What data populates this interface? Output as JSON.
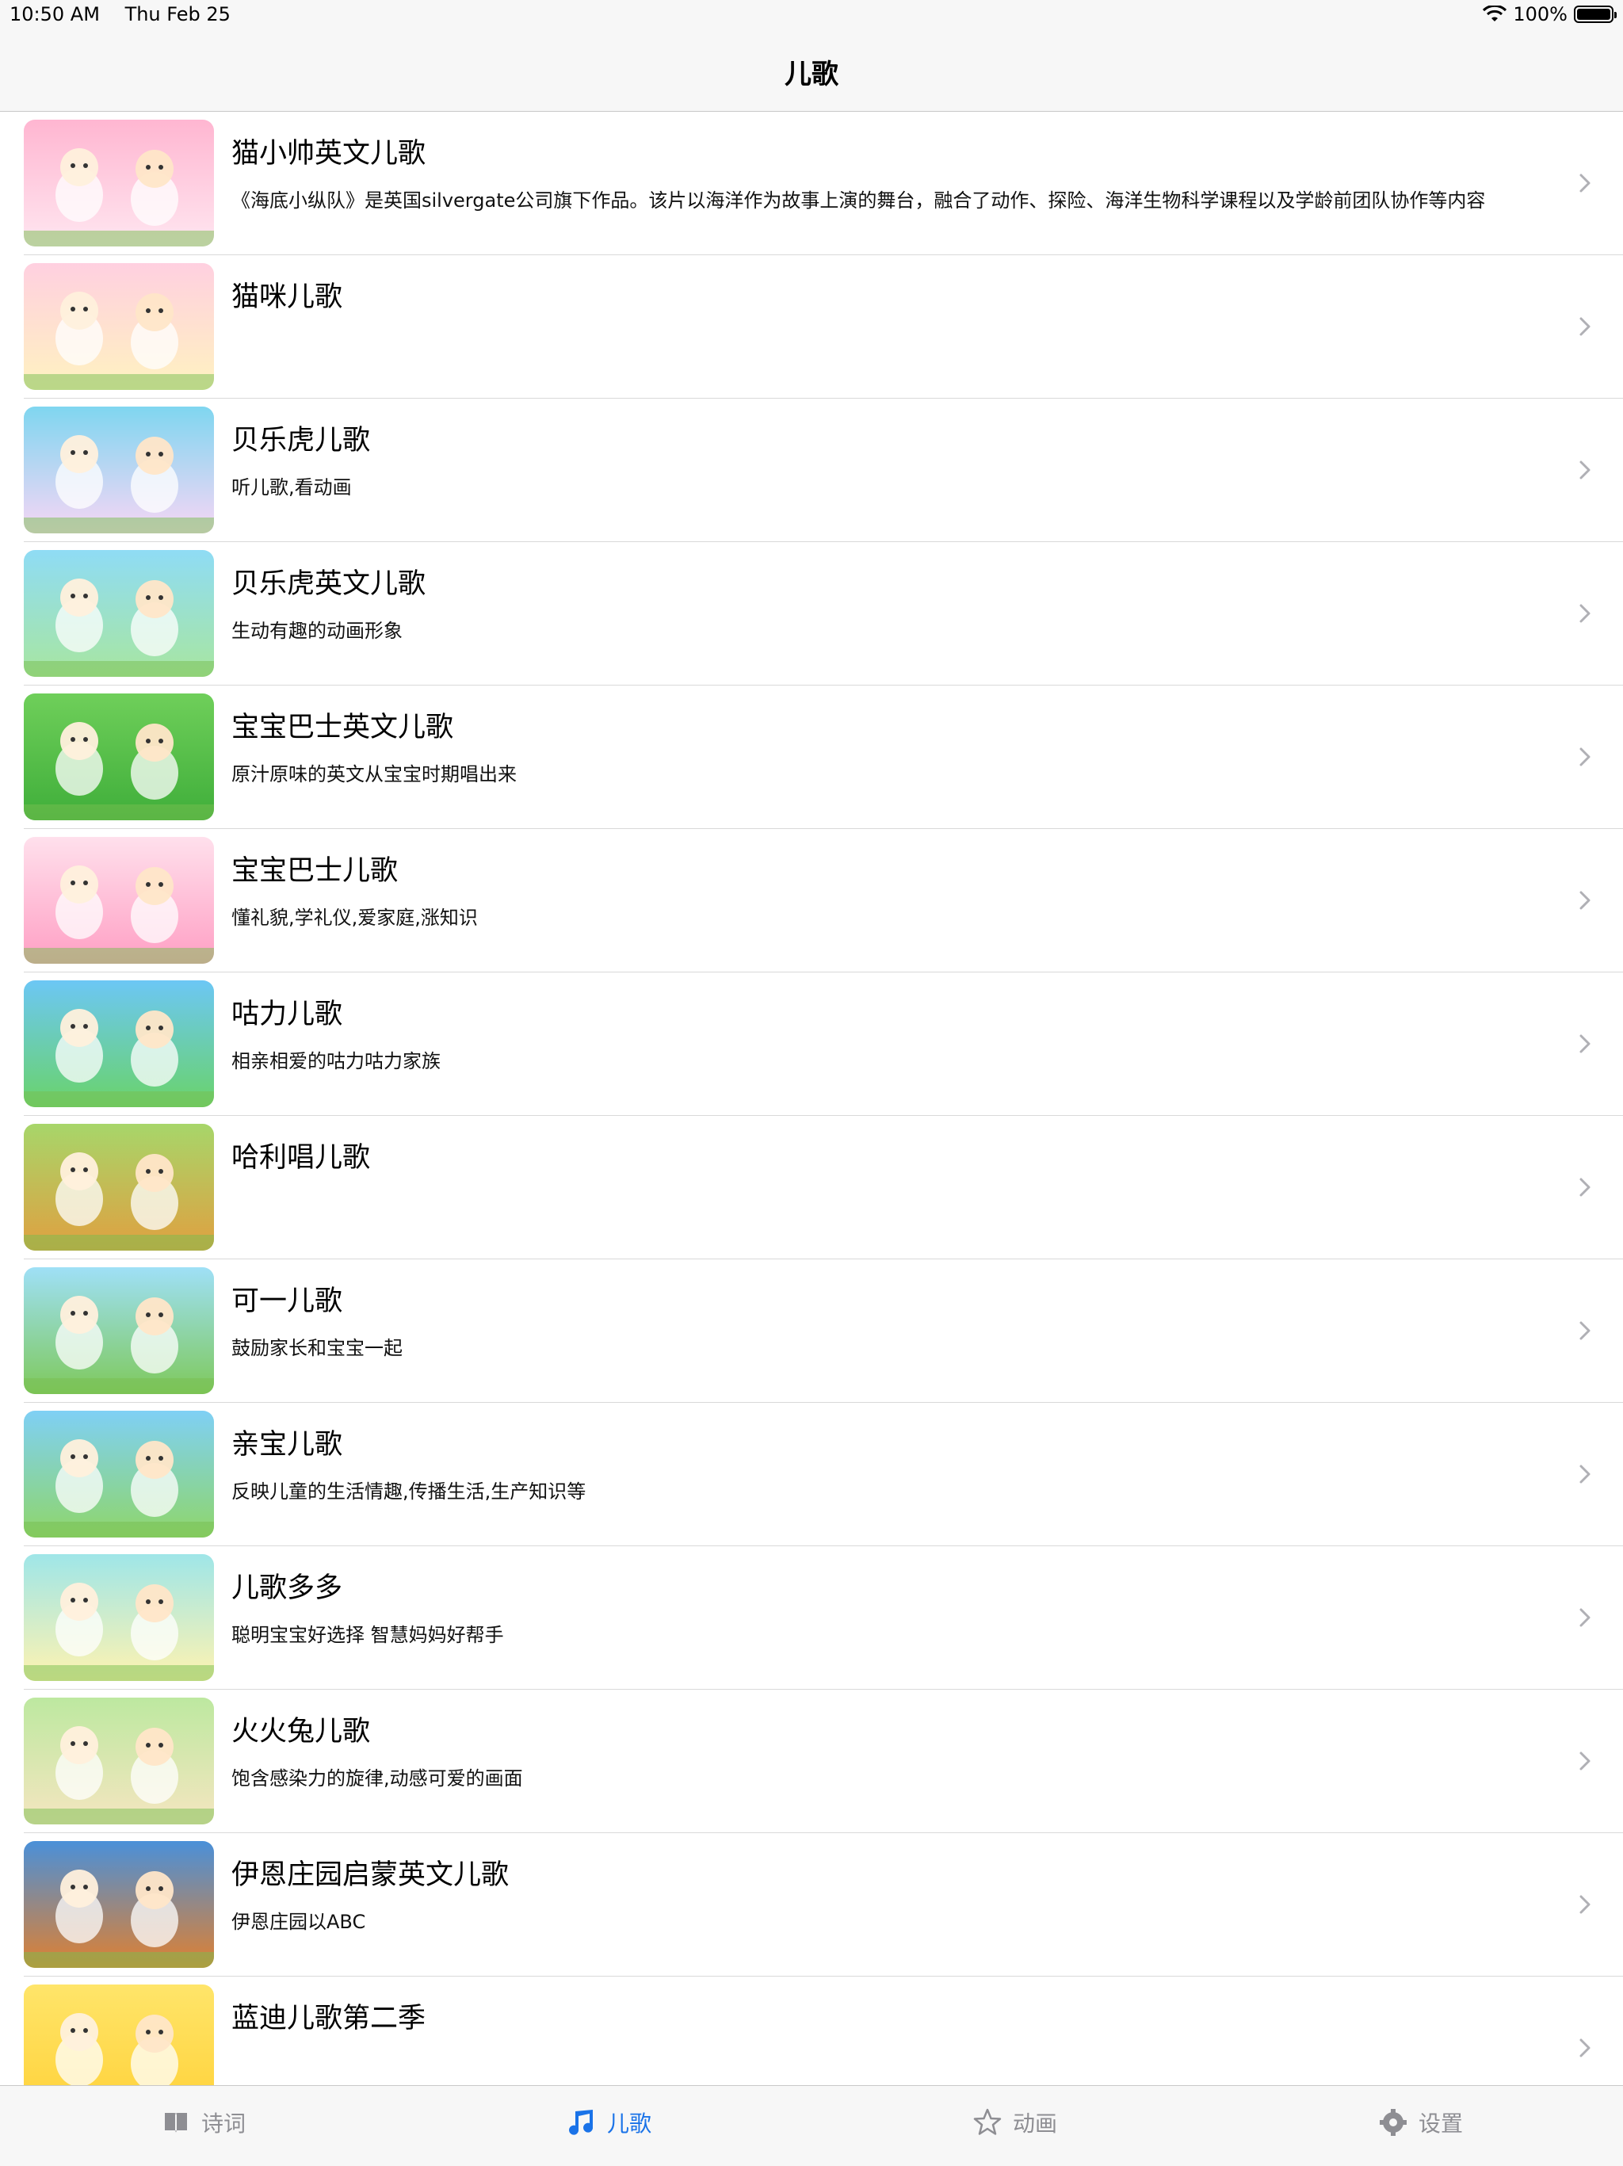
{
  "status": {
    "time": "10:50 AM",
    "date": "Thu Feb 25",
    "battery": "100%",
    "battery_level": 1.0
  },
  "nav": {
    "title": "儿歌"
  },
  "rows": [
    {
      "title": "猫小帅英文儿歌",
      "subtitle": "《海底小纵队》是英国silvergate公司旗下作品。该片以海洋作为故事上演的舞台，融合了动作、探险、海洋生物科学课程以及学龄前团队协作等内容",
      "colors": [
        "#ffb6d1",
        "#ffe6f0"
      ]
    },
    {
      "title": "猫咪儿歌",
      "subtitle": "",
      "colors": [
        "#ffd0e0",
        "#fff2c0"
      ]
    },
    {
      "title": "贝乐虎儿歌",
      "subtitle": "听儿歌,看动画",
      "colors": [
        "#7fd6f0",
        "#f7d6f5"
      ]
    },
    {
      "title": "贝乐虎英文儿歌",
      "subtitle": "生动有趣的动画形象",
      "colors": [
        "#8fdcf5",
        "#a8e6a0"
      ]
    },
    {
      "title": "宝宝巴士英文儿歌",
      "subtitle": "原汁原味的英文从宝宝时期唱出来",
      "colors": [
        "#6fcf5a",
        "#3fae3a"
      ]
    },
    {
      "title": "宝宝巴士儿歌",
      "subtitle": "懂礼貌,学礼仪,爱家庭,涨知识",
      "colors": [
        "#ffe0ec",
        "#ff9fc4"
      ]
    },
    {
      "title": "咕力儿歌",
      "subtitle": "相亲相爱的咕力咕力家族",
      "colors": [
        "#6cc7f5",
        "#6ad36a"
      ]
    },
    {
      "title": "哈利唱儿歌",
      "subtitle": "",
      "colors": [
        "#a7d66a",
        "#e0a040"
      ]
    },
    {
      "title": "可一儿歌",
      "subtitle": "鼓励家长和宝宝一起",
      "colors": [
        "#9fe0f7",
        "#7ec95a"
      ]
    },
    {
      "title": "亲宝儿歌",
      "subtitle": "反映儿童的生活情趣,传播生活,生产知识等",
      "colors": [
        "#7fd0f5",
        "#8fd66a"
      ]
    },
    {
      "title": "儿歌多多",
      "subtitle": "聪明宝宝好选择 智慧妈妈好帮手",
      "colors": [
        "#9fe6e8",
        "#fff3b0"
      ]
    },
    {
      "title": "火火兔儿歌",
      "subtitle": "饱含感染力的旋律,动感可爱的画面",
      "colors": [
        "#bde8a0",
        "#f5e6c0"
      ]
    },
    {
      "title": "伊恩庄园启蒙英文儿歌",
      "subtitle": "伊恩庄园以ABC",
      "colors": [
        "#4a90d9",
        "#e08030"
      ]
    },
    {
      "title": "蓝迪儿歌第二季",
      "subtitle": "",
      "colors": [
        "#ffe56a",
        "#ffd23a"
      ]
    }
  ],
  "tabs": [
    {
      "label": "诗词",
      "icon": "book-icon",
      "active": false
    },
    {
      "label": "儿歌",
      "icon": "music-note-icon",
      "active": true
    },
    {
      "label": "动画",
      "icon": "star-icon",
      "active": false
    },
    {
      "label": "设置",
      "icon": "gear-icon",
      "active": false
    }
  ],
  "theme": {
    "accent": "#1a73e8",
    "inactive": "#8e8e93"
  }
}
